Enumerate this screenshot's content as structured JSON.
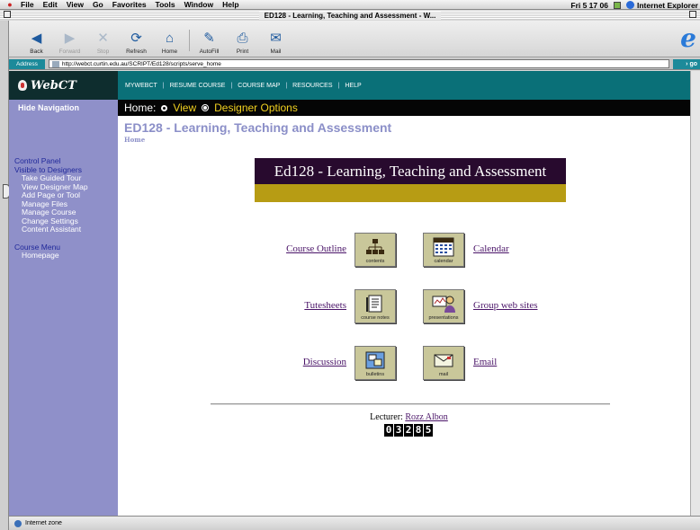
{
  "menubar": {
    "items": [
      "File",
      "Edit",
      "View",
      "Go",
      "Favorites",
      "Tools",
      "Window",
      "Help"
    ],
    "clock": "Fri 5 17 06",
    "app_name": "Internet Explorer"
  },
  "window": {
    "title": "ED128 - Learning, Teaching and Assessment - W..."
  },
  "toolbar": {
    "buttons": [
      {
        "label": "Back",
        "icon": "back-arrow-icon"
      },
      {
        "label": "Forward",
        "icon": "forward-arrow-icon"
      },
      {
        "label": "Stop",
        "icon": "stop-icon"
      },
      {
        "label": "Refresh",
        "icon": "refresh-icon"
      },
      {
        "label": "Home",
        "icon": "home-icon"
      },
      {
        "label": "AutoFill",
        "icon": "autofill-icon"
      },
      {
        "label": "Print",
        "icon": "print-icon"
      },
      {
        "label": "Mail",
        "icon": "mail-icon"
      }
    ]
  },
  "address": {
    "label": "Address",
    "url": "http://webct.curtin.edu.au/SCRIPT/Ed128/scripts/serve_home",
    "go": "go"
  },
  "sidebar": {
    "logo": "WebCT",
    "hide_nav": "Hide Navigation",
    "control_panel": "Control Panel",
    "visible": "Visible to Designers",
    "designer_items": [
      "Take Guided Tour",
      "View Designer Map",
      "Add Page or Tool",
      "Manage Files",
      "Manage Course",
      "Change Settings",
      "Content Assistant"
    ],
    "course_menu": "Course Menu",
    "course_items": [
      "Homepage"
    ]
  },
  "topnav": {
    "items": [
      "MYWEBCT",
      "RESUME COURSE",
      "COURSE MAP",
      "RESOURCES",
      "HELP"
    ]
  },
  "modebar": {
    "home": "Home:",
    "view": "View",
    "designer": "Designer Options"
  },
  "content": {
    "title": "ED128 - Learning, Teaching and Assessment",
    "breadcrumb": "Home",
    "banner": "Ed128 - Learning, Teaching and Assessment",
    "links": {
      "course_outline": "Course Outline",
      "calendar": "Calendar",
      "tutesheets": "Tutesheets",
      "group_web_sites": "Group web sites",
      "discussion": "Discussion",
      "email": "Email"
    },
    "buttons": {
      "contents": "contents",
      "calendar": "calendar",
      "course_notes": "course notes",
      "presentations": "presentations",
      "bulletins": "bulletins",
      "mail": "mail"
    },
    "lecturer_label": "Lecturer:",
    "lecturer_name": "Rozz Albon",
    "counter": [
      "0",
      "3",
      "2",
      "8",
      "5"
    ]
  },
  "status": {
    "zone": "Internet zone"
  },
  "colors": {
    "sidebar": "#8f90c9",
    "topnav": "#0a7078",
    "banner": "#280a2e",
    "banner_strip": "#b79c14",
    "link": "#4a1468"
  }
}
